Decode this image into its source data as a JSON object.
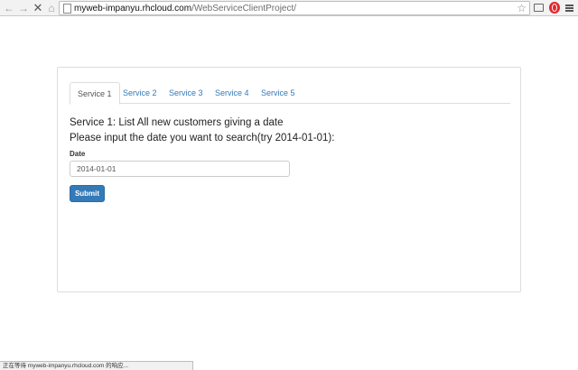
{
  "browser": {
    "url_host": "myweb-impanyu.rhcloud.com",
    "url_path": "/WebServiceClientProject/",
    "status_text": "正在等待 myweb-impanyu.rhcloud.com 的响应..."
  },
  "tabs": [
    {
      "label": "Service 1",
      "active": true
    },
    {
      "label": "Service 2",
      "active": false
    },
    {
      "label": "Service 3",
      "active": false
    },
    {
      "label": "Service 4",
      "active": false
    },
    {
      "label": "Service 5",
      "active": false
    }
  ],
  "content": {
    "title": "Service 1: List All new customers giving a date",
    "instruction": "Please input the date you want to search(try 2014-01-01):",
    "date_label": "Date",
    "date_value": "2014-01-01",
    "submit_label": "Submit"
  },
  "colors": {
    "primary": "#337ab7",
    "tab_link": "#337ab7",
    "border": "#dddddd"
  }
}
